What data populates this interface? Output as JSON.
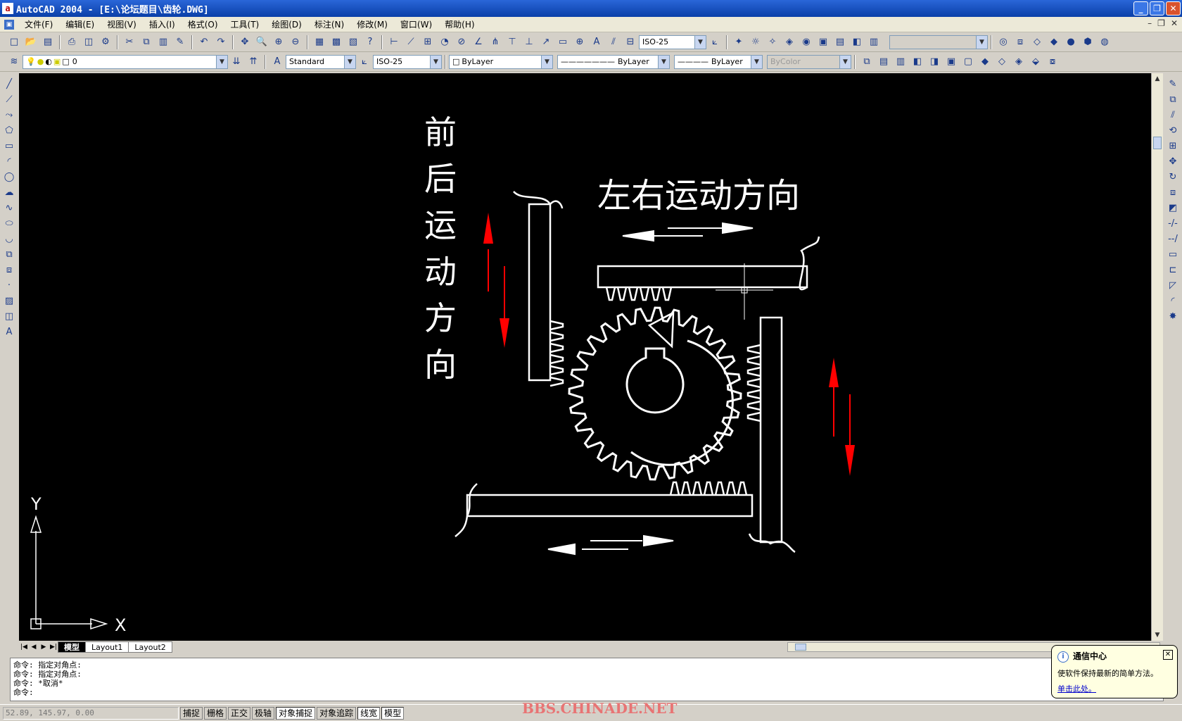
{
  "window": {
    "title": "AutoCAD 2004 - [E:\\论坛题目\\齿轮.DWG]",
    "minimize_icon": "minimize-icon",
    "maximize_icon": "maximize-icon",
    "close_icon": "close-icon"
  },
  "menu": {
    "items": [
      "文件(F)",
      "编辑(E)",
      "视图(V)",
      "插入(I)",
      "格式(O)",
      "工具(T)",
      "绘图(D)",
      "标注(N)",
      "修改(M)",
      "窗口(W)",
      "帮助(H)"
    ]
  },
  "toolbar1": {
    "dimstyle": "ISO-25"
  },
  "toolbar2": {
    "layer": "0",
    "textstyle": "Standard",
    "dimstyle": "ISO-25",
    "color": "ByLayer",
    "linetype": "ByLayer",
    "lineweight": "ByLayer",
    "plotstyle": "ByColor"
  },
  "drawing": {
    "label_vertical": [
      "前",
      "后",
      "运",
      "动",
      "方",
      "向"
    ],
    "label_horizontal": "左右运动方向",
    "ucs_y": "Y",
    "ucs_x": "X",
    "line_color": "#ffffff",
    "arrow_color": "#ff0000"
  },
  "layout_tabs": [
    "模型",
    "Layout1",
    "Layout2"
  ],
  "command": {
    "lines": [
      "命令: 指定对角点:",
      "命令: 指定对角点:",
      "命令: *取消*",
      "命令:"
    ]
  },
  "status": {
    "coords": "52.89, 145.97, 0.00",
    "buttons": [
      "捕捉",
      "栅格",
      "正交",
      "极轴",
      "对象捕捉",
      "对象追踪",
      "线宽",
      "模型"
    ],
    "active": [
      4,
      6,
      7
    ]
  },
  "watermark": "BBS.CHINADE.NET",
  "notification": {
    "title": "通信中心",
    "message": "使软件保持最新的简单方法。",
    "link": "单击此处。"
  }
}
